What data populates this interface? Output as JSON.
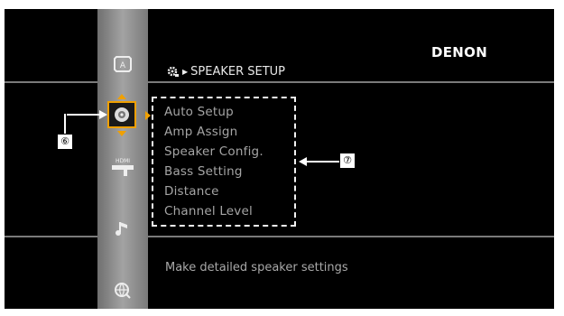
{
  "header": {
    "brand": "DENON",
    "title": "SPEAKER SETUP"
  },
  "sidebar": {
    "items": [
      {
        "icon": "input-setup-icon"
      },
      {
        "icon": "speaker-setup-icon",
        "selected": true
      },
      {
        "icon": "hdmi-setup-icon",
        "label": "HDMI"
      },
      {
        "icon": "audio-setup-icon"
      },
      {
        "icon": "network-setup-icon"
      }
    ]
  },
  "menu": {
    "items": [
      "Auto Setup",
      "Amp Assign",
      "Speaker Config.",
      "Bass Setting",
      "Distance",
      "Channel Level"
    ]
  },
  "description": "Make detailed speaker settings",
  "callouts": {
    "sidebar_icon": "⑥",
    "menu_list": "⑦"
  },
  "colors": {
    "background": "#000000",
    "sidebar": "#8f8f8f",
    "accent": "#f0a000",
    "menu_text": "#a5a5a5"
  }
}
